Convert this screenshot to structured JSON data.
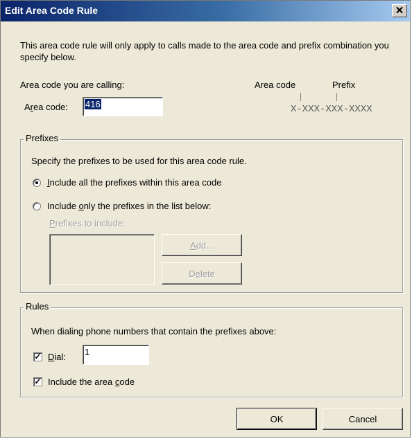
{
  "window": {
    "title": "Edit Area Code Rule",
    "close_glyph": "✕"
  },
  "description": "This area code rule will only apply to calls made to the area code and prefix combination you specify below.",
  "area_code_section": {
    "heading": "Area code you are calling:",
    "label": "Area code:",
    "value": "416"
  },
  "format_hint": {
    "area_code_label": "Area code",
    "prefix_label": "Prefix",
    "pattern": "X-XXX-XXX-XXXX"
  },
  "prefixes": {
    "group_label": "Prefixes",
    "instruction": "Specify the prefixes to be used for this area code rule.",
    "option_all": "Include all the prefixes within this area code",
    "option_list": "Include only the prefixes in the list below:",
    "selected": "all",
    "list_label": "Prefixes to include:",
    "add_label": "Add...",
    "delete_label": "Delete"
  },
  "rules": {
    "group_label": "Rules",
    "instruction": "When dialing phone numbers that contain the prefixes above:",
    "dial_label": "Dial:",
    "dial_checked": true,
    "dial_value": "1",
    "include_area_code_label": "Include the area code",
    "include_area_code_checked": true
  },
  "footer": {
    "ok_label": "OK",
    "cancel_label": "Cancel"
  }
}
